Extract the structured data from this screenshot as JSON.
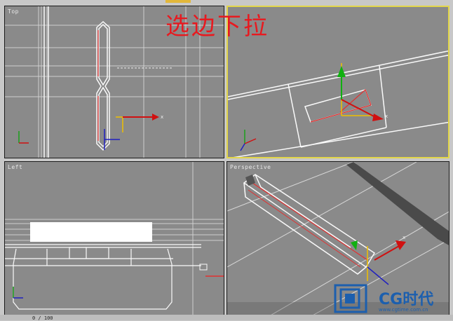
{
  "headline": "选边下拉",
  "viewports": {
    "top": {
      "label": "Top"
    },
    "front": {
      "label": ""
    },
    "left": {
      "label": "Left"
    },
    "perspective": {
      "label": "Perspective"
    }
  },
  "timeline": {
    "frame_counter": "0 / 100"
  },
  "watermark": {
    "name": "CG时代",
    "url": "www.cgtime.com.cn"
  },
  "colors": {
    "active_border": "#e2d64a",
    "headline": "#e8191f",
    "logo": "#1c5fae",
    "selected_edge": "#e23030"
  }
}
